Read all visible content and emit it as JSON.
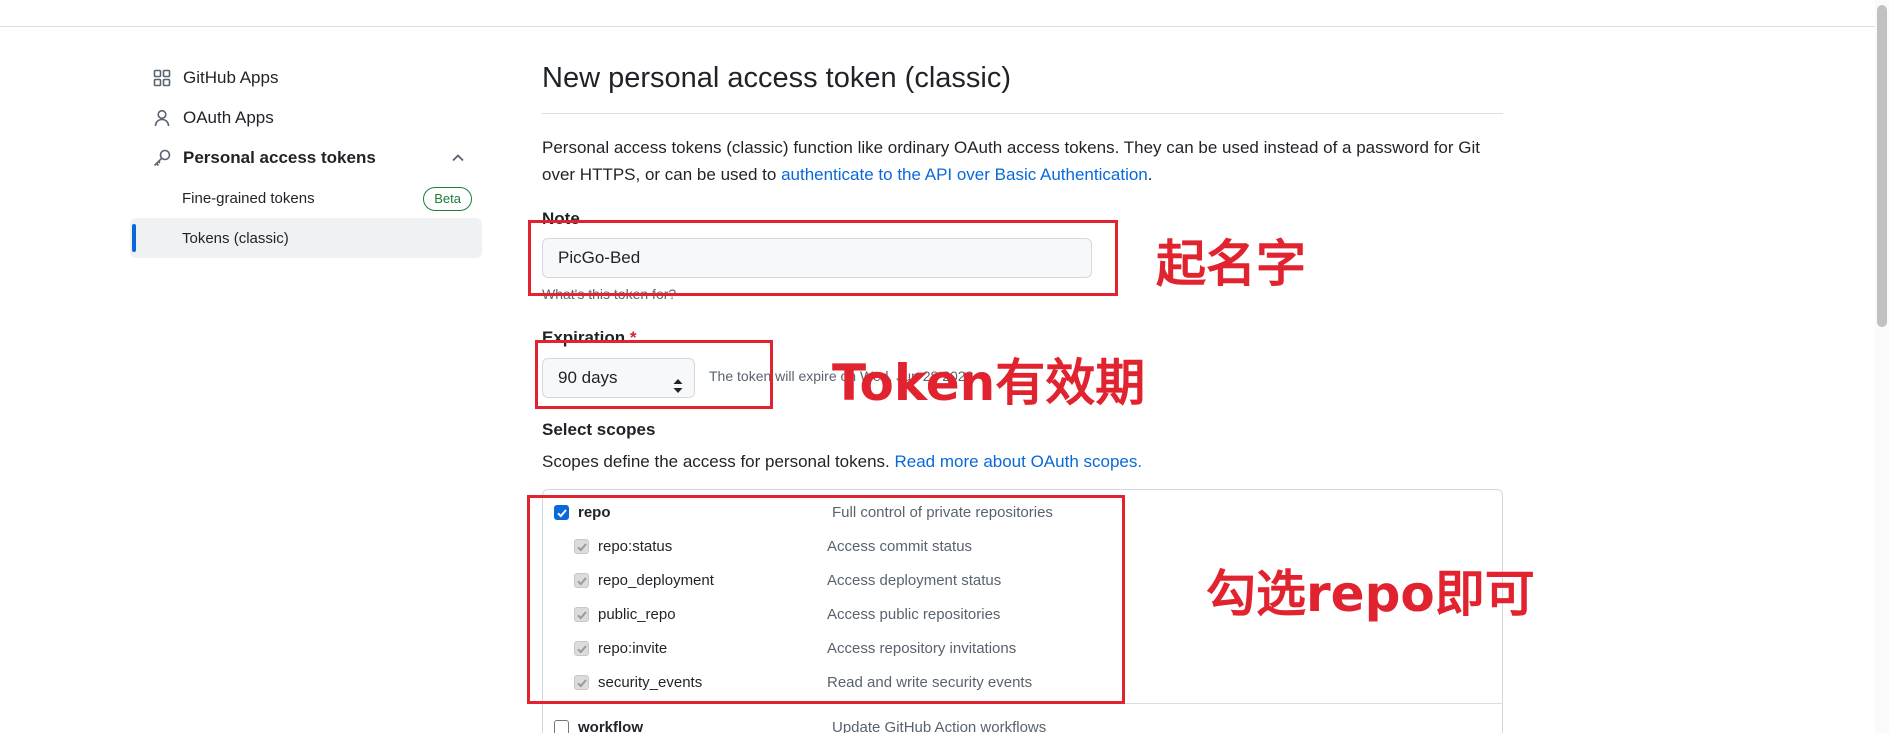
{
  "sidebar": {
    "items": [
      {
        "label": "GitHub Apps",
        "icon": "apps-grid-icon"
      },
      {
        "label": "OAuth Apps",
        "icon": "person-icon"
      },
      {
        "label": "Personal access tokens",
        "icon": "key-icon",
        "expanded": true
      }
    ],
    "subitems": [
      {
        "label": "Fine-grained tokens",
        "badge": "Beta"
      },
      {
        "label": "Tokens (classic)",
        "active": true
      }
    ]
  },
  "main": {
    "title": "New personal access token (classic)",
    "description_text": "Personal access tokens (classic) function like ordinary OAuth access tokens. They can be used instead of a password for Git over HTTPS, or can be used to ",
    "description_link": "authenticate to the API over Basic Authentication",
    "description_end": ".",
    "note_label": "Note",
    "note_value": "PicGo-Bed",
    "note_hint": "What's this token for?",
    "expiration_label": "Expiration",
    "expiration_required_mark": "*",
    "expiration_value": "90 days",
    "expiration_text": "The token will expire on Wed, Jun 28 2023",
    "scopes_label": "Select scopes",
    "scopes_desc": "Scopes define the access for personal tokens.",
    "scopes_link": "Read more about OAuth scopes."
  },
  "scopes": [
    {
      "name": "repo",
      "desc": "Full control of private repositories",
      "checked": true,
      "level": 0
    },
    {
      "name": "repo:status",
      "desc": "Access commit status",
      "checked": true,
      "disabled": true,
      "level": 1
    },
    {
      "name": "repo_deployment",
      "desc": "Access deployment status",
      "checked": true,
      "disabled": true,
      "level": 1
    },
    {
      "name": "public_repo",
      "desc": "Access public repositories",
      "checked": true,
      "disabled": true,
      "level": 1
    },
    {
      "name": "repo:invite",
      "desc": "Access repository invitations",
      "checked": true,
      "disabled": true,
      "level": 1
    },
    {
      "name": "security_events",
      "desc": "Read and write security events",
      "checked": true,
      "disabled": true,
      "level": 1
    },
    {
      "name": "workflow",
      "desc": "Update GitHub Action workflows",
      "checked": false,
      "level": 0
    }
  ],
  "annotations": {
    "name_hint": "起名字",
    "expiry_hint": "Token有效期",
    "repo_hint": "勾选repo即可"
  },
  "colors": {
    "accent": "#0969da",
    "annotation_red": "#e0232e",
    "beta_green": "#1a7f37"
  }
}
